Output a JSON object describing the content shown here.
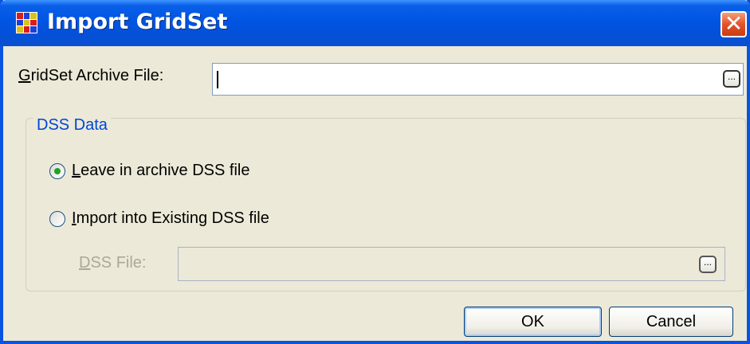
{
  "window": {
    "title": "Import GridSet",
    "icon": "gridset-icon",
    "close_glyph": "✕"
  },
  "archive": {
    "label_mnemonic": "G",
    "label_rest": "ridSet Archive File:",
    "value": "",
    "browse_label": "..."
  },
  "dss_group": {
    "legend": "DSS Data",
    "options": [
      {
        "mnemonic": "L",
        "rest": "eave in archive DSS file",
        "selected": true
      },
      {
        "mnemonic": "I",
        "rest": "mport into Existing DSS file",
        "selected": false
      }
    ],
    "dss_file": {
      "label_mnemonic": "D",
      "label_rest": "SS File:",
      "value": "",
      "browse_label": "...",
      "enabled": false
    }
  },
  "buttons": {
    "ok_label": "OK",
    "cancel_label": "Cancel"
  },
  "colors": {
    "titlebar": "#0055e3",
    "legend": "#0046d5",
    "radio_selected": "#21a121",
    "close": "#e2532a"
  }
}
